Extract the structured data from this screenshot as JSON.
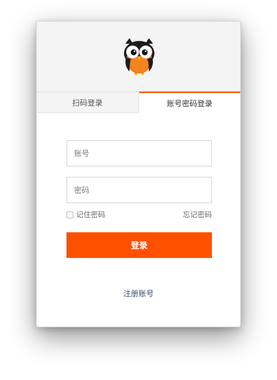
{
  "header": {
    "logo_icon": "owl-logo-icon"
  },
  "tabs": [
    {
      "label": "扫码登录",
      "active": false
    },
    {
      "label": "账号密码登录",
      "active": true
    }
  ],
  "form": {
    "account_placeholder": "账号",
    "account_value": "",
    "password_placeholder": "密码",
    "password_value": "",
    "remember_label": "记住密码",
    "remember_checked": false,
    "forgot_label": "忘记密码",
    "login_label": "登录",
    "register_label": "注册账号"
  },
  "colors": {
    "accent": "#ff5000",
    "link": "#3b4a72"
  }
}
